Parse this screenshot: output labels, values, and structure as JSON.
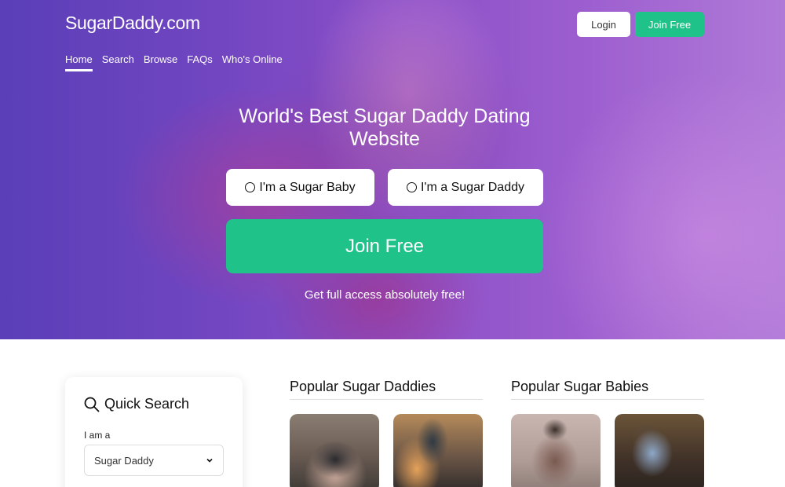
{
  "header": {
    "logo_main": "SugarDaddy",
    "logo_suffix": ".com",
    "login_label": "Login",
    "join_label": "Join Free"
  },
  "nav": {
    "items": [
      {
        "label": "Home",
        "active": true
      },
      {
        "label": "Search",
        "active": false
      },
      {
        "label": "Browse",
        "active": false
      },
      {
        "label": "FAQs",
        "active": false
      },
      {
        "label": "Who's Online",
        "active": false
      }
    ]
  },
  "hero": {
    "headline_line1": "World's Best Sugar Daddy Dating",
    "headline_line2": "Website",
    "role_options": [
      "I'm a Sugar Baby",
      "I'm a Sugar Daddy"
    ],
    "join_button": "Join Free",
    "tagline": "Get full access absolutely free!"
  },
  "quick_search": {
    "title": "Quick Search",
    "label": "I am a",
    "selected": "Sugar Daddy",
    "icon": "search-icon"
  },
  "sections": {
    "daddies_title": "Popular Sugar Daddies",
    "babies_title": "Popular Sugar Babies"
  },
  "colors": {
    "accent": "#1fc38a",
    "hero_left": "#5a3fb8",
    "hero_right": "#b07ad8"
  }
}
